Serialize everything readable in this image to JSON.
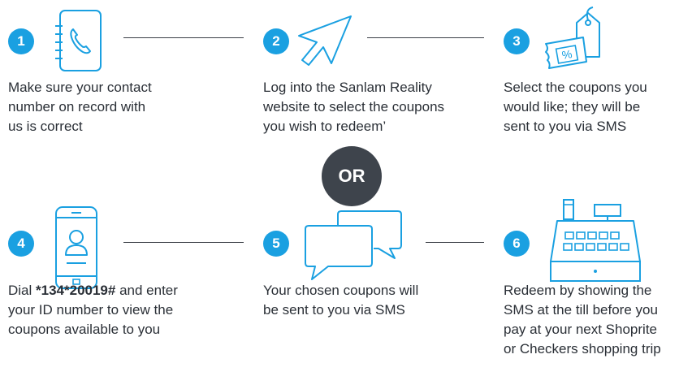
{
  "colors": {
    "accent": "#1aa0e1",
    "text": "#2a2f36",
    "or_bg": "#3e444c",
    "line": "#3a3f46"
  },
  "steps": [
    {
      "number": "1",
      "icon": "phone-book-icon",
      "text": "Make sure your contact\nnumber on record with\nus is correct"
    },
    {
      "number": "2",
      "icon": "cursor-arrow-icon",
      "text": "Log into the Sanlam Reality\nwebsite to select the coupons\nyou wish to redeem’"
    },
    {
      "number": "3",
      "icon": "coupon-tags-icon",
      "icon_label": "%",
      "text": "Select the coupons you\nwould like; they will be\nsent to you via SMS"
    },
    {
      "number": "4",
      "icon": "mobile-profile-icon",
      "text_before": "Dial ",
      "text_bold": "*134*20019#",
      "text_after": " and enter\nyour ID number to view the\ncoupons available to you"
    },
    {
      "number": "5",
      "icon": "chat-bubbles-icon",
      "text": "Your chosen coupons will\nbe sent to you via SMS"
    },
    {
      "number": "6",
      "icon": "cash-register-icon",
      "text": "Redeem by showing the\nSMS at the till before you\npay at your next Shoprite\nor Checkers shopping trip"
    }
  ],
  "or_label": "OR"
}
